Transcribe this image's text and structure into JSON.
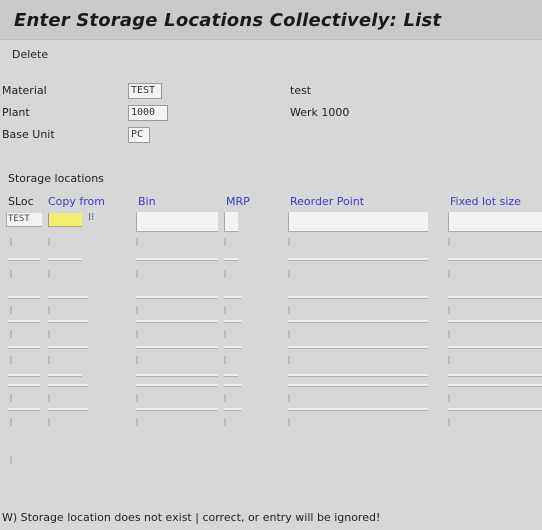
{
  "window": {
    "title": "Enter Storage Locations Collectively: List"
  },
  "toolbar": {
    "delete_label": "Delete"
  },
  "header": {
    "material": {
      "label": "Material",
      "value": "TEST",
      "description": "test"
    },
    "plant": {
      "label": "Plant",
      "value": "1000",
      "description": "Werk 1000"
    },
    "base_unit": {
      "label": "Base Unit",
      "value": "PC"
    }
  },
  "table": {
    "section_title": "Storage locations",
    "columns": {
      "sloc": "SLoc",
      "copy_from": "Copy from",
      "bin": "Bin",
      "mrp": "MRP",
      "reorder_point": "Reorder Point",
      "fixed_lot_size": "Fixed lot size"
    },
    "first_row": {
      "sloc": "TEST"
    }
  },
  "status": {
    "message": "W) Storage location does not exist | correct, or entry will be ignored!"
  }
}
